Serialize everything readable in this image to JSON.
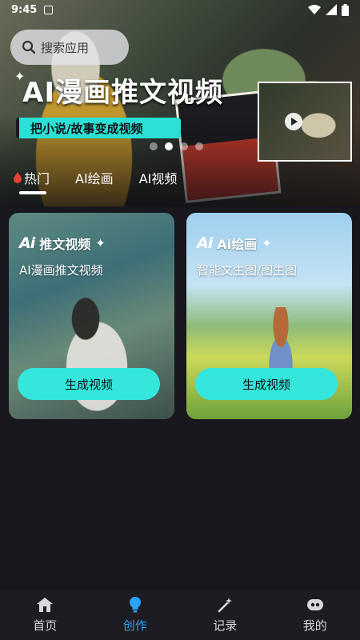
{
  "status_bar": {
    "time": "9:45"
  },
  "search": {
    "placeholder": "搜索应用"
  },
  "banner": {
    "title": "AI漫画推文视频",
    "subtitle": "把小说/故事变成视频",
    "slides_total": 4,
    "active_slide": 2
  },
  "tabs": [
    {
      "label": "热门",
      "active": true
    },
    {
      "label": "AI绘画",
      "active": false
    },
    {
      "label": "AI视频",
      "active": false
    }
  ],
  "cards": [
    {
      "logo": "Ai",
      "title": "推文视频",
      "desc": "AI漫画推文视频",
      "button": "生成视频"
    },
    {
      "logo": "Ai",
      "title": "Ai绘画",
      "desc": "智能文生图/图生图",
      "button": "生成视频"
    }
  ],
  "nav": [
    {
      "label": "首页",
      "icon": "home-icon",
      "active": false
    },
    {
      "label": "创作",
      "icon": "bulb-icon",
      "active": true
    },
    {
      "label": "记录",
      "icon": "magic-wand-icon",
      "active": false
    },
    {
      "label": "我的",
      "icon": "profile-icon",
      "active": false
    }
  ],
  "colors": {
    "accent": "#34e6dc",
    "nav_active": "#2aa4ff",
    "background": "#17171d"
  }
}
